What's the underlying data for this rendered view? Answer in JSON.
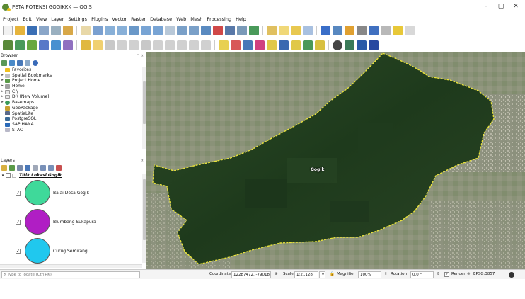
{
  "window": {
    "title": "PETA POTENSI GOGIKKK — QGIS",
    "controls": [
      "–",
      "▢",
      "✕"
    ]
  },
  "menu": [
    "Project",
    "Edit",
    "View",
    "Layer",
    "Settings",
    "Plugins",
    "Vector",
    "Raster",
    "Database",
    "Web",
    "Mesh",
    "Processing",
    "Help"
  ],
  "browser": {
    "title": "Browser",
    "items": [
      {
        "label": "Favorites",
        "icon": "star-icon"
      },
      {
        "label": "Spatial Bookmarks",
        "icon": "bookmark-icon"
      },
      {
        "label": "Project Home",
        "icon": "folder-icon"
      },
      {
        "label": "Home",
        "icon": "folder-icon"
      },
      {
        "label": "C:\\",
        "icon": "drive-icon"
      },
      {
        "label": "D:\\ (New Volume)",
        "icon": "drive-icon"
      },
      {
        "label": "Basemaps",
        "icon": "globe-icon"
      },
      {
        "label": "GeoPackage",
        "icon": "geopackage-icon"
      },
      {
        "label": "SpatiaLite",
        "icon": "spatialite-icon"
      },
      {
        "label": "PostgreSQL",
        "icon": "postgresql-icon"
      },
      {
        "label": "SAP HANA",
        "icon": "sap-hana-icon"
      },
      {
        "label": "STAC",
        "icon": "stac-icon"
      }
    ]
  },
  "layers": {
    "title": "Layers",
    "group": "Titik Lokasi Gogik",
    "items": [
      {
        "label": "Balai Desa Gogik",
        "color": "#3fd99a"
      },
      {
        "label": "Blumbang Sukapura",
        "color": "#b01ec4"
      },
      {
        "label": "Curug Semirang",
        "color": "#20c8ee"
      }
    ]
  },
  "map": {
    "place_label": "Gogik",
    "boundary_color": "#e8e23a"
  },
  "status": {
    "locator_placeholder": "Type to locate (Ctrl+K)",
    "coordinate_label": "Coordinate",
    "coordinate_value": "12287472, -790180",
    "scale_label": "Scale",
    "scale_value": "1:21128",
    "magnifier_label": "Magnifier",
    "magnifier_value": "100%",
    "rotation_label": "Rotation",
    "rotation_value": "0.0 °",
    "render_label": "Render",
    "crs": "EPSG:3857"
  }
}
